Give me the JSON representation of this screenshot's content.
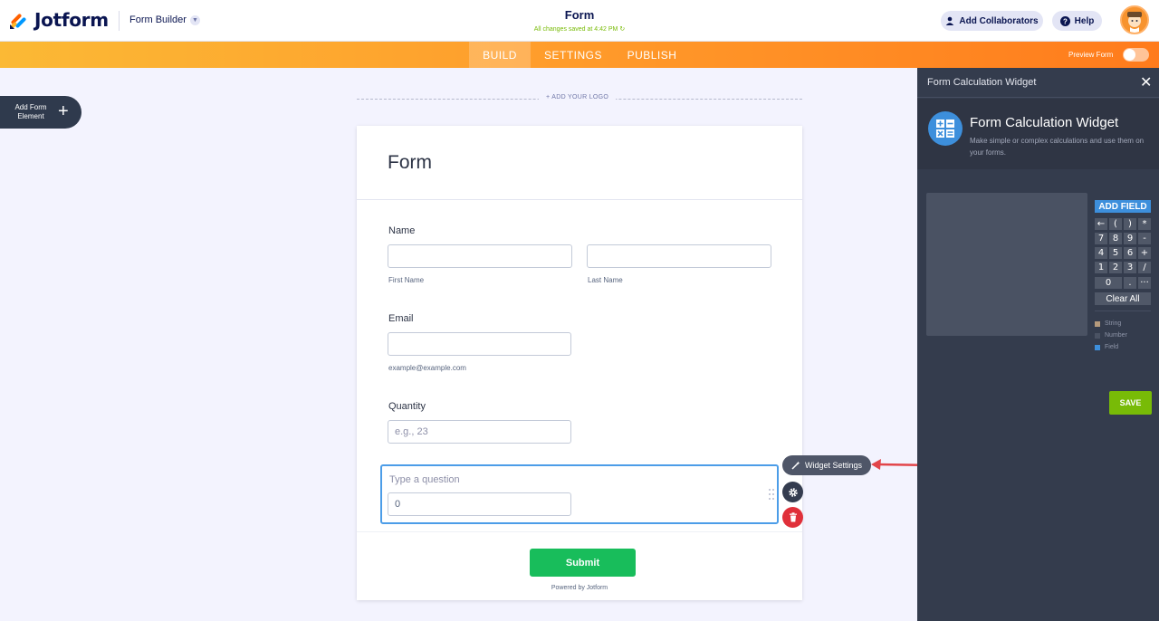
{
  "header": {
    "brand": "Jotform",
    "builder_label": "Form Builder",
    "form_title": "Form",
    "saved_status": "All changes saved at 4:42 PM",
    "collaborators_label": "Add Collaborators",
    "help_label": "Help"
  },
  "nav": {
    "tabs": [
      {
        "label": "BUILD",
        "active": true
      },
      {
        "label": "SETTINGS",
        "active": false
      },
      {
        "label": "PUBLISH",
        "active": false
      }
    ],
    "preview_label": "Preview Form",
    "preview_on": false
  },
  "sidebar": {
    "add_element_label": "Add Form Element",
    "plus": "+"
  },
  "canvas": {
    "add_logo_label": "+ ADD YOUR LOGO",
    "heading": "Form",
    "fields": {
      "name": {
        "label": "Name",
        "first_sublabel": "First Name",
        "last_sublabel": "Last Name",
        "first_value": "",
        "last_value": ""
      },
      "email": {
        "label": "Email",
        "value": "",
        "sublabel": "example@example.com"
      },
      "quantity": {
        "label": "Quantity",
        "placeholder": "e.g., 23",
        "value": ""
      },
      "calculation": {
        "question_placeholder": "Type a question",
        "value": "0"
      }
    },
    "submit_label": "Submit",
    "powered_by": "Powered by Jotform"
  },
  "widget_controls": {
    "settings_label": "Widget Settings"
  },
  "panel": {
    "title": "Form Calculation Widget",
    "widget_name": "Form Calculation Widget",
    "widget_description": "Make simple or complex calculations and use them on your forms.",
    "add_field_label": "ADD FIELD",
    "keys": [
      [
        "←",
        "(",
        ")",
        "*"
      ],
      [
        "7",
        "8",
        "9",
        "-"
      ],
      [
        "4",
        "5",
        "6",
        "+"
      ],
      [
        "1",
        "2",
        "3",
        "/"
      ],
      [
        "0",
        ".",
        "···"
      ]
    ],
    "clear_all_label": "Clear All",
    "legend": [
      {
        "label": "String",
        "color": "#b59a7c"
      },
      {
        "label": "Number",
        "color": "#4a5263"
      },
      {
        "label": "Field",
        "color": "#3d8fdc"
      }
    ],
    "save_label": "SAVE"
  },
  "colors": {
    "accent_orange": "#ff7b1c",
    "focus_blue": "#4c9de8",
    "submit_green": "#18bd5b",
    "save_green": "#78bb07",
    "delete_red": "#e0303a",
    "annotation_arrow": "#e2454a"
  }
}
